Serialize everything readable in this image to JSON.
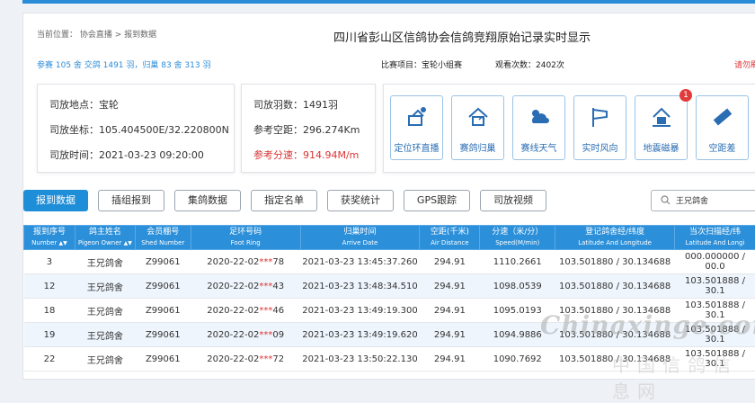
{
  "breadcrumb": {
    "prefix": "当前位置：",
    "items": [
      "协会直播",
      "报到数据"
    ],
    "sep": " > "
  },
  "page_title": "四川省彭山区信鸽协会信鸽竞翔原始记录实时显示",
  "stats_text": "参赛 105 舍 交鸽 1491 羽，归巢 83 舍 313 羽",
  "project_text": "比赛项目：宝轮小组赛",
  "views_text": "观看次数：2402次",
  "right_link": "请勿刷",
  "release_info": {
    "place": "司放地点：宝轮",
    "coord": "司放坐标：105.404500E/32.220800N",
    "time": "司放时间：2021-03-23 09:20:00"
  },
  "summary": {
    "count": "司放羽数：1491羽",
    "distance": "参考空距：296.274Km",
    "speed": "参考分速：914.94M/m"
  },
  "quick_buttons": [
    {
      "label": "定位环直播",
      "icon": "satellite-icon"
    },
    {
      "label": "赛鸽归巢",
      "icon": "home-icon"
    },
    {
      "label": "赛线天气",
      "icon": "weather-icon"
    },
    {
      "label": "实时风向",
      "icon": "wind-icon"
    },
    {
      "label": "地震磁暴",
      "icon": "earthquake-icon",
      "badge": "1"
    },
    {
      "label": "空距差",
      "icon": "ruler-icon"
    }
  ],
  "tabs": [
    "报到数据",
    "插组报到",
    "集鸽数据",
    "指定名单",
    "获奖统计",
    "GPS跟踪",
    "司放视频"
  ],
  "search": {
    "value": "王兄鸽舍"
  },
  "table": {
    "headers": [
      {
        "cn": "报到序号",
        "en": "Number"
      },
      {
        "cn": "鸽主姓名",
        "en": "Pigeon Owner"
      },
      {
        "cn": "会员棚号",
        "en": "Shed Number"
      },
      {
        "cn": "足环号码",
        "en": "Foot Ring"
      },
      {
        "cn": "归巢时间",
        "en": "Arrive Date"
      },
      {
        "cn": "空距(千米)",
        "en": "Air Distance"
      },
      {
        "cn": "分速（米/分）",
        "en": "Speed(M/min)"
      },
      {
        "cn": "登记鸽舍经/纬度",
        "en": "Latitude And Longitude"
      },
      {
        "cn": "当次扫描经/纬",
        "en": "Latitude And Longi"
      }
    ],
    "rows": [
      {
        "num": "3",
        "owner": "王兄鸽舍",
        "shed": "Z99061",
        "ring_a": "2020-22-02",
        "ring_mask": "***",
        "ring_b": "78",
        "time": "2021-03-23 13:45:37.260",
        "dist": "294.91",
        "speed": "1110.2661",
        "reg": "103.501880 / 30.134688",
        "scan": "000.000000 / 00.0"
      },
      {
        "num": "12",
        "owner": "王兄鸽舍",
        "shed": "Z99061",
        "ring_a": "2020-22-02",
        "ring_mask": "***",
        "ring_b": "43",
        "time": "2021-03-23 13:48:34.510",
        "dist": "294.91",
        "speed": "1098.0539",
        "reg": "103.501880 / 30.134688",
        "scan": "103.501888 / 30.1"
      },
      {
        "num": "18",
        "owner": "王兄鸽舍",
        "shed": "Z99061",
        "ring_a": "2020-22-02",
        "ring_mask": "***",
        "ring_b": "46",
        "time": "2021-03-23 13:49:19.300",
        "dist": "294.91",
        "speed": "1095.0193",
        "reg": "103.501880 / 30.134688",
        "scan": "103.501888 / 30.1"
      },
      {
        "num": "19",
        "owner": "王兄鸽舍",
        "shed": "Z99061",
        "ring_a": "2020-22-02",
        "ring_mask": "***",
        "ring_b": "09",
        "time": "2021-03-23 13:49:19.620",
        "dist": "294.91",
        "speed": "1094.9886",
        "reg": "103.501880 / 30.134688",
        "scan": "103.501888 / 30.1"
      },
      {
        "num": "22",
        "owner": "王兄鸽舍",
        "shed": "Z99061",
        "ring_a": "2020-22-02",
        "ring_mask": "***",
        "ring_b": "72",
        "time": "2021-03-23 13:50:22.130",
        "dist": "294.91",
        "speed": "1090.7692",
        "reg": "103.501880 / 30.134688",
        "scan": "103.501888 / 30.1"
      }
    ]
  },
  "watermark": {
    "brand": "Chinaxinge.com",
    "cn": "中国信鸽信息网"
  },
  "colors": {
    "accent": "#2a8bd8",
    "header_bg": "#2b8fd9",
    "alert": "#d33333"
  }
}
